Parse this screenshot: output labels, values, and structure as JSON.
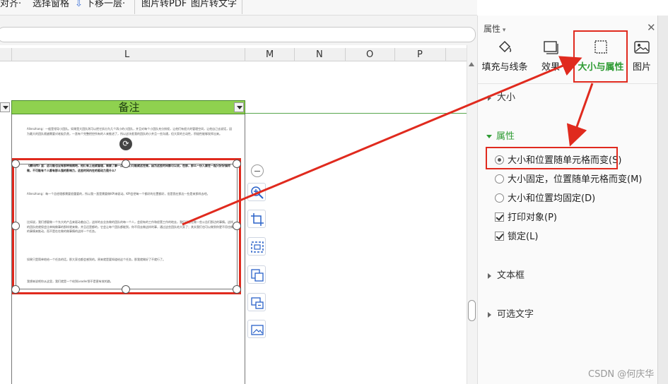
{
  "toolbar": {
    "items": [
      {
        "label": "对齐·"
      },
      {
        "label": "选择窗格"
      },
      {
        "label": "下移一层·"
      },
      {
        "label": "图片转PDF"
      },
      {
        "label": "图片转文字"
      }
    ]
  },
  "sheet": {
    "columns": [
      "L",
      "M",
      "N",
      "O",
      "P"
    ],
    "remark_header": "备注"
  },
  "doc_image": {
    "paragraphs": [
      "Allenzhang：一般是领导小团队。如果是大团队则可以把它拆分为几个再小的小团队，并且对每个小团队充分授权，让他们有很大的管理空间，让他自己去说话，因为最大的团队就越需要对老板负责，一直有个完整把控所有的人来推进了，所以这块差我的团队的小并且一些沟通，但大家的主动性，积极性能够发挥出来。",
      "《腾讯传》里：这可能也没有那种规模吧，他们有上班就管理，需要了解一点，我们可能就这在做，因为这些时间都可以说，在那，那么一份入要在一起只好好操你做，不可能有个人都有那么强的影响力，这些时间内在的驱动力是什么？",
      "Allenzhang：每一个总经理都需要很重要的，所以我一直是需要做KPI来驱动。KPI会把每一个都好的位置都好，但是我在那边一些是来那样去吧。",
      "比如说，我们想要做一个东大的产品来驱动着自己，这样的去业务做的团队的每一个人，会很有的工作和经营工作的地去，我们还是在做一些公告们那边的事情。这样的团队他就保会比单纯做事的那样就来做，并且还是都的，它会让每个团队都能到，你不用去做这样的事，通过这些团队给大家了；其实我们也可以做到你更不用也做的事情来推动，而不是在在做的做事情的这样一个任务。",
      "如果只是简单地给一个任务的话，那大家也都会感到的。原来就是要知道给这个任务，那我就做好了不就行了。",
      "我想来说吧你从这里，我们就是一个给到Leader那不是更有效的路，"
    ]
  },
  "quick_tools": [
    {
      "icon": "zoom-out-icon"
    },
    {
      "icon": "zoom-in-icon"
    },
    {
      "icon": "crop-icon"
    },
    {
      "icon": "image-fit-icon"
    },
    {
      "icon": "copy-image-icon"
    },
    {
      "icon": "replace-image-icon"
    },
    {
      "icon": "image-edit-icon"
    }
  ],
  "panel": {
    "title": "属性",
    "tabs": [
      {
        "label": "填充与线条",
        "icon": "fill-bucket-icon"
      },
      {
        "label": "效果",
        "icon": "effect-icon"
      },
      {
        "label": "大小与属性",
        "icon": "size-property-icon",
        "active": true
      },
      {
        "label": "图片",
        "icon": "picture-icon"
      }
    ],
    "sections": {
      "size": "大小",
      "attributes": "属性",
      "textbox": "文本框",
      "alt_text": "可选文字"
    },
    "radio_options": [
      {
        "label": "大小和位置随单元格而变(S)",
        "checked": true
      },
      {
        "label": "大小固定，位置随单元格而变(M)",
        "checked": false
      },
      {
        "label": "大小和位置均固定(D)",
        "checked": false
      }
    ],
    "checkbox_options": [
      {
        "label": "打印对象(P)",
        "checked": true
      },
      {
        "label": "锁定(L)",
        "checked": true
      }
    ]
  },
  "watermark": "CSDN @何庆华",
  "colors": {
    "accent_green": "#2e9b33",
    "header_green": "#8fd14f",
    "annotation_red": "#e02a1e"
  }
}
